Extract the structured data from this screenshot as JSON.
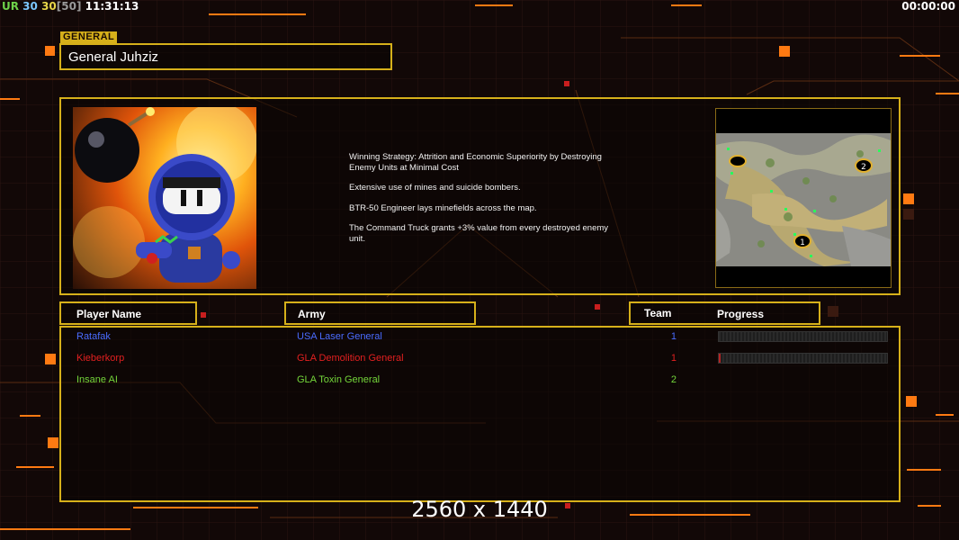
{
  "hud": {
    "ur": "UR",
    "val1": "30",
    "val2": "30",
    "val3": "[50]",
    "clock": "11:31:13",
    "timer": "00:00:00"
  },
  "general": {
    "tab_label": "GENERAL",
    "name": "General Juhziz",
    "portrait_icon": "bomber-portrait-icon",
    "description": [
      "Winning Strategy: Attrition and Economic Superiority by Destroying\n Enemy Units at Minimal Cost",
      "Extensive use of mines and suicide bombers.",
      "BTR-50 Engineer lays minefields across the map.",
      "The Command Truck grants +3% value from every destroyed enemy\n unit."
    ],
    "map_icon": "minimap-icon",
    "map_slots": [
      "2",
      "1"
    ]
  },
  "table": {
    "headers": {
      "player": "Player Name",
      "army": "Army",
      "team": "Team",
      "progress": "Progress"
    },
    "rows": [
      {
        "player": "Ratafak",
        "army": "USA Laser General",
        "team": "1",
        "color": "#4a6cff",
        "progress": 0
      },
      {
        "player": "Kieberkorp",
        "army": "GLA Demolition General",
        "team": "1",
        "color": "#e22020",
        "progress": 0.01
      },
      {
        "player": "Insane AI",
        "army": "GLA Toxin General",
        "team": "2",
        "color": "#74d63a",
        "progress": null
      }
    ]
  },
  "resolution": "2560 x 1440",
  "colors": {
    "frame": "#d6b01a",
    "accent": "#ff7a12"
  }
}
